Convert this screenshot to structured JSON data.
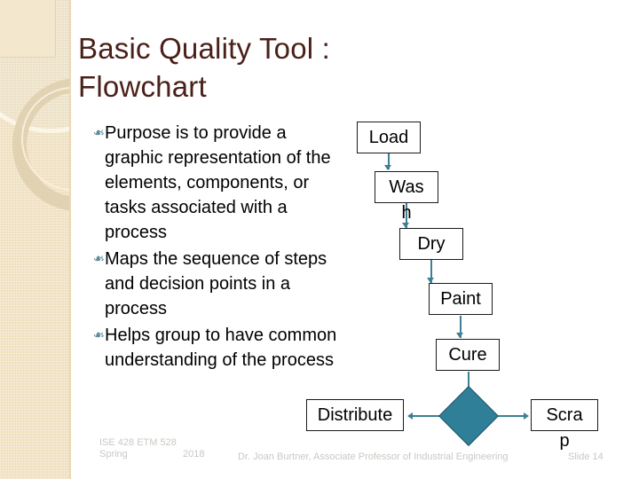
{
  "slide": {
    "title": "Basic Quality Tool :\nFlowchart",
    "bullet_glyph": "❧",
    "bullets": [
      "Purpose is to provide a graphic representation of the elements, components, or tasks associated with a process",
      "Maps the sequence of steps and decision points in a process",
      "Helps group to have common understanding of the process"
    ]
  },
  "colors": {
    "title": "#4a2018",
    "band": "#efdfbe",
    "connector": "#3d7f93",
    "diamond_fill": "#2f7f99",
    "diamond_stroke": "#1d5568",
    "bullet_glyph": "#5f8e9c",
    "footer": "#c8c8c4",
    "box_stroke": "#1a1a1a"
  },
  "flowchart": {
    "nodes": [
      {
        "id": "load",
        "label": "Load",
        "overflow": "",
        "shape": "process"
      },
      {
        "id": "wash",
        "label": "Was",
        "overflow": "h",
        "shape": "process"
      },
      {
        "id": "dry",
        "label": "Dry",
        "overflow": "",
        "shape": "process"
      },
      {
        "id": "paint",
        "label": "Paint",
        "overflow": "",
        "shape": "process"
      },
      {
        "id": "cure",
        "label": "Cure",
        "overflow": "",
        "shape": "process"
      },
      {
        "id": "decision",
        "label": "",
        "overflow": "",
        "shape": "decision"
      },
      {
        "id": "distribute",
        "label": "Distribute",
        "overflow": "",
        "shape": "process"
      },
      {
        "id": "scrap",
        "label": "Scra",
        "overflow": "p",
        "shape": "process"
      }
    ]
  },
  "footer": {
    "course": "ISE 428 ETM 528 Spring",
    "year": "2018",
    "credit": "Dr. Joan Burtner, Associate Professor of Industrial Engineering",
    "slide_number": "Slide 14"
  }
}
